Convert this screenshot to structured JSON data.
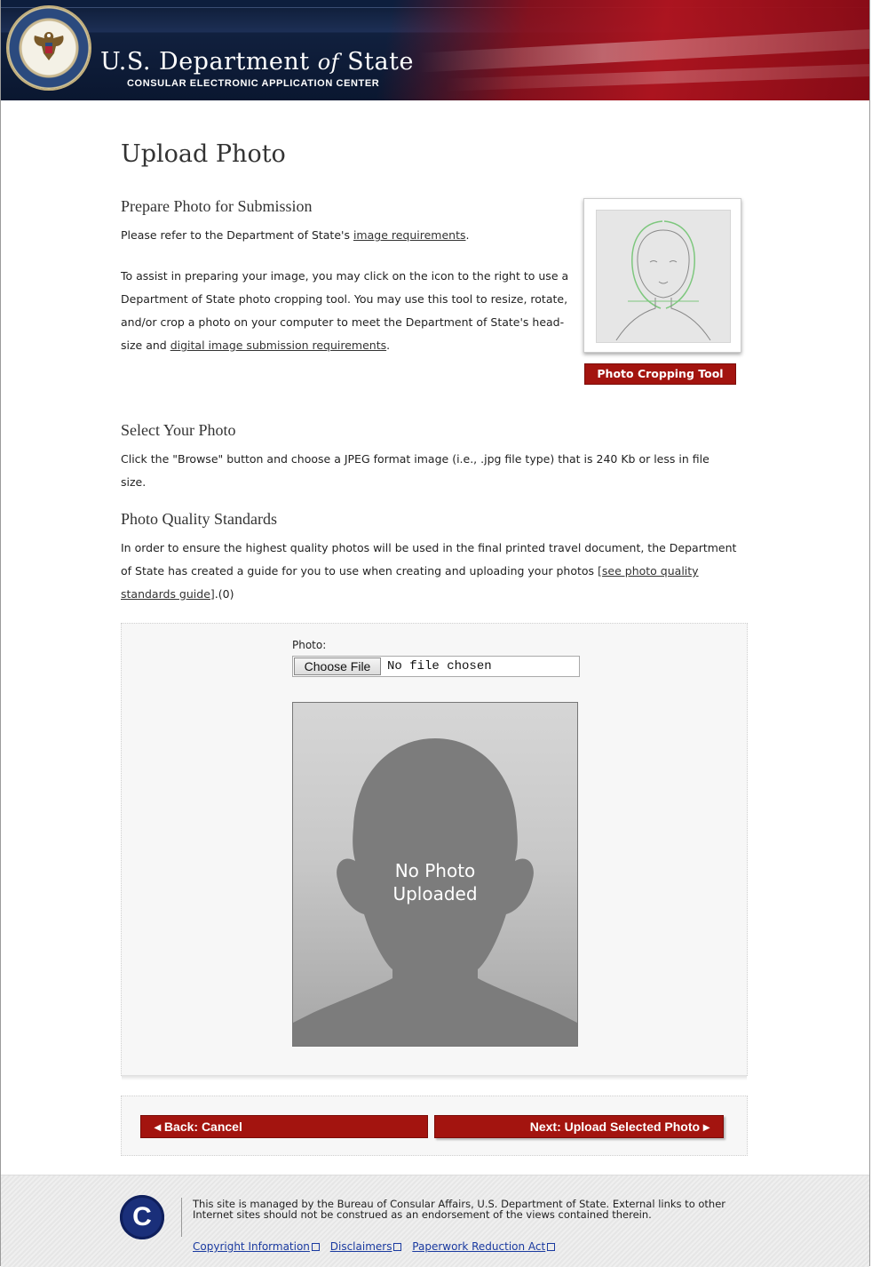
{
  "header": {
    "title_main": "U.S. Department ",
    "title_of": "of",
    "title_state": " State",
    "subtitle": "CONSULAR ELECTRONIC APPLICATION CENTER"
  },
  "page_title": "Upload Photo",
  "prepare": {
    "heading": "Prepare Photo for Submission",
    "refer_prefix": "Please refer to the Department of State's ",
    "refer_link": "image requirements",
    "refer_suffix": ".",
    "assist_text": "To assist in preparing your image, you may click on the icon to the right to use a Department of State photo cropping tool. You may use this tool to resize, rotate, and/or crop a photo on your computer to meet the Department of State's head-size and ",
    "assist_link": "digital image submission requirements",
    "assist_suffix": ".",
    "crop_button": "Photo Cropping Tool"
  },
  "select": {
    "heading": "Select Your Photo",
    "text": "Click the \"Browse\" button and choose a JPEG format image (i.e., .jpg file type) that is 240 Kb or less in file size."
  },
  "quality": {
    "heading": "Photo Quality Standards",
    "text": "In order to ensure the highest quality photos will be used in the final printed travel document, the Department of State has created a guide for you to use when creating and uploading your photos ",
    "link": "[see photo quality standards guide]",
    "suffix": ".(0)"
  },
  "upload": {
    "label": "Photo:",
    "choose_button": "Choose File",
    "file_status": "No file chosen",
    "placeholder_line1": "No Photo",
    "placeholder_line2": "Uploaded"
  },
  "nav": {
    "back": "◂ Back: Cancel",
    "next": "Next: Upload Selected Photo ▸"
  },
  "footer": {
    "text": "This site is managed by the Bureau of Consular Affairs, U.S. Department of State. External links to other Internet sites should not be construed as an endorsement of the views contained therein.",
    "links": [
      "Copyright Information",
      "Disclaimers",
      "Paperwork Reduction Act"
    ],
    "logo_letter": "C"
  },
  "colors": {
    "accent_red": "#a3140f",
    "header_navy": "#0c1a33",
    "footer_logo": "#1a2f7a"
  }
}
